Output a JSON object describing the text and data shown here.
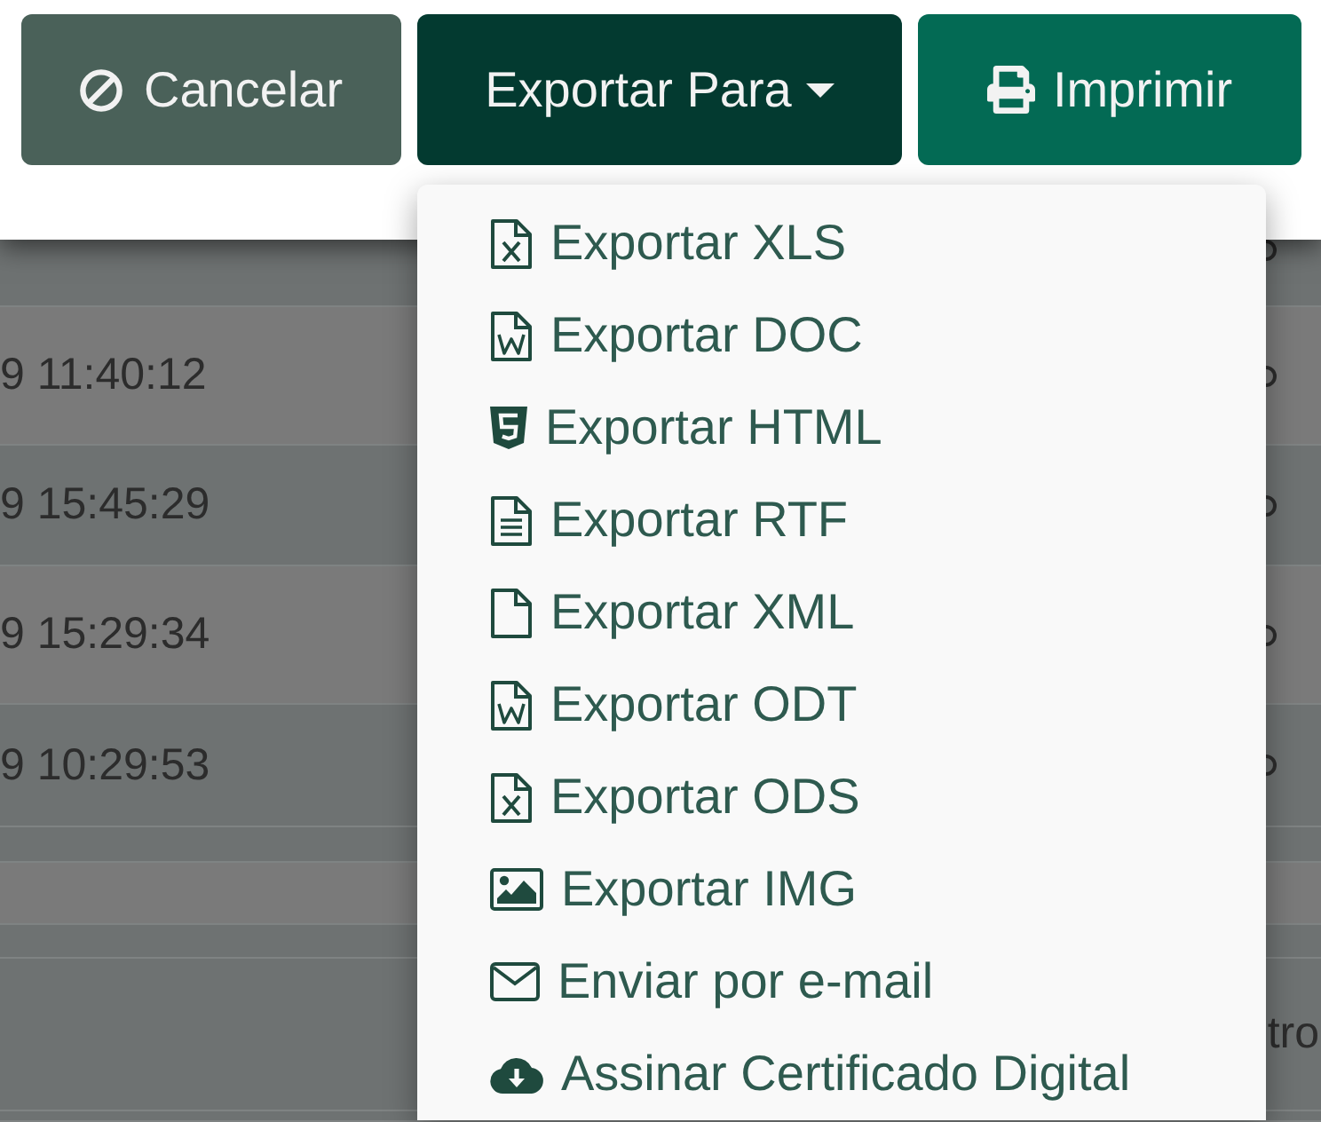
{
  "toolbar": {
    "buttons": [
      {
        "label": "Cancelar",
        "kind": "cancel"
      },
      {
        "label": "Exportar Para",
        "kind": "dropdown",
        "expanded": true
      },
      {
        "label": "Imprimir",
        "kind": "print"
      }
    ]
  },
  "export_menu": {
    "items": [
      {
        "label": "Exportar XLS",
        "kind": "xls"
      },
      {
        "label": "Exportar DOC",
        "kind": "doc"
      },
      {
        "label": "Exportar HTML",
        "kind": "html"
      },
      {
        "label": "Exportar RTF",
        "kind": "rtf"
      },
      {
        "label": "Exportar XML",
        "kind": "xml"
      },
      {
        "label": "Exportar ODT",
        "kind": "odt"
      },
      {
        "label": "Exportar ODS",
        "kind": "ods"
      },
      {
        "label": "Exportar IMG",
        "kind": "img"
      },
      {
        "label": "Enviar por e-mail",
        "kind": "email"
      },
      {
        "label": "Assinar Certificado Digital",
        "kind": "certificate"
      }
    ]
  },
  "table": {
    "rows": [
      {
        "column_1": "9 11:40:12"
      },
      {
        "column_1": "9 15:45:29"
      },
      {
        "column_1": "9 15:29:34"
      },
      {
        "column_1": "9 10:29:53"
      },
      {
        "column_last": "tro"
      }
    ]
  }
}
